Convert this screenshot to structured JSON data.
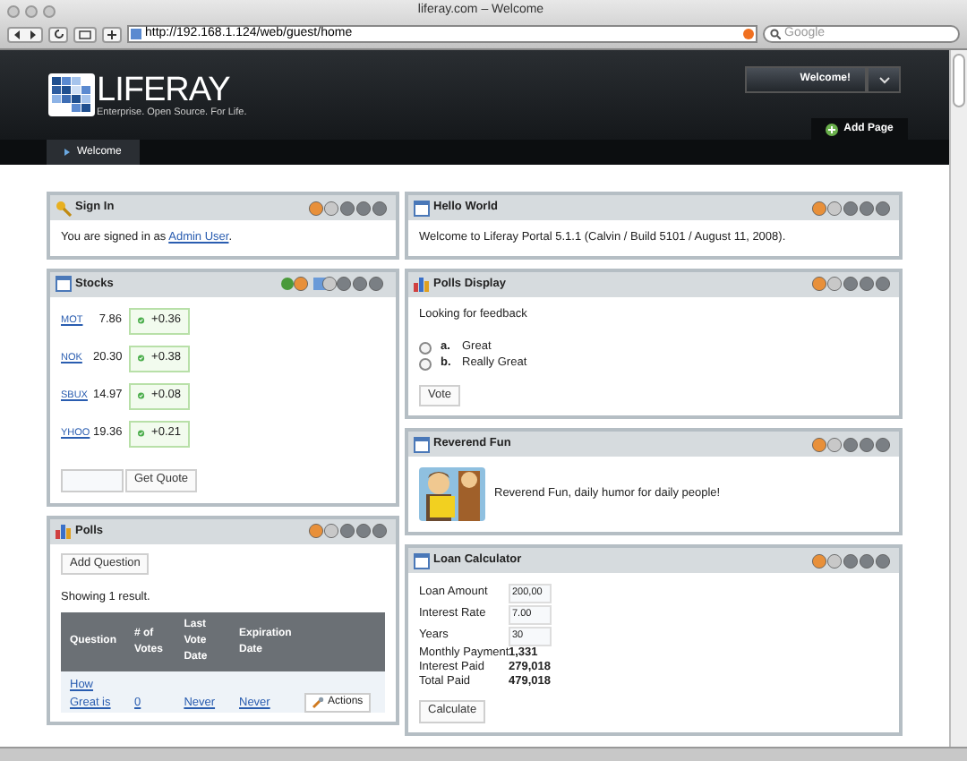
{
  "browser": {
    "title": "liferay.com – Welcome",
    "url": "http://192.168.1.124/web/guest/home",
    "search_placeholder": "Google"
  },
  "header": {
    "logo_text": "LIFERAY",
    "tagline": "Enterprise. Open Source. For Life.",
    "welcome_button": "Welcome!",
    "add_page": "Add Page"
  },
  "nav": [
    {
      "label": "Welcome",
      "selected": true
    }
  ],
  "left_column": [
    {
      "kind": "signin",
      "title": "Sign In",
      "text": "You are signed in as ",
      "link": "Admin User",
      "text_end": "."
    },
    {
      "kind": "stocks",
      "title": "Stocks",
      "stocks": [
        {
          "symbol": "MOT",
          "price": "7.86",
          "change": "+0.36"
        },
        {
          "symbol": "NOK",
          "price": "20.30",
          "change": "+0.38"
        },
        {
          "symbol": "SBUX",
          "price": "14.97",
          "change": "+0.08"
        },
        {
          "symbol": "YHOO",
          "price": "19.36",
          "change": "+0.21"
        }
      ],
      "button": "Get Quote"
    },
    {
      "kind": "polls",
      "title": "Polls",
      "button": "Add Question",
      "summary": "Showing 1 result.",
      "columns": [
        "Question",
        "# of Votes",
        "Last Vote Date",
        "Expiration Date"
      ],
      "rows": [
        {
          "question": "How Great is",
          "votes": "0",
          "last_vote": "Never",
          "expiration": "Never",
          "actions": "Actions"
        }
      ]
    }
  ],
  "right_column": [
    {
      "kind": "hello",
      "title": "Hello World",
      "text": "Welcome to Liferay Portal 5.1.1 (Calvin / Build 5101 / August 11, 2008)."
    },
    {
      "kind": "pollsdisplay",
      "title": "Polls Display",
      "question": "Looking for feedback",
      "options": [
        {
          "letter": "a.",
          "label": "Great",
          "selected": false
        },
        {
          "letter": "b.",
          "label": "Really Great",
          "selected": false
        }
      ],
      "button": "Vote"
    },
    {
      "kind": "comic",
      "title": "Reverend Fun",
      "text": "Reverend Fun, daily humor for daily people!"
    },
    {
      "kind": "loan",
      "title": "Loan Calculator",
      "fields": [
        {
          "label": "Loan Amount",
          "value": "200,00"
        },
        {
          "label": "Interest Rate",
          "value": "7.00"
        },
        {
          "label": "Years",
          "value": "30"
        }
      ],
      "results": [
        {
          "label": "Monthly Payment",
          "value": "1,331"
        },
        {
          "label": "Interest Paid",
          "value": "279,018"
        },
        {
          "label": "Total Paid",
          "value": "479,018"
        }
      ],
      "button": "Calculate"
    }
  ]
}
